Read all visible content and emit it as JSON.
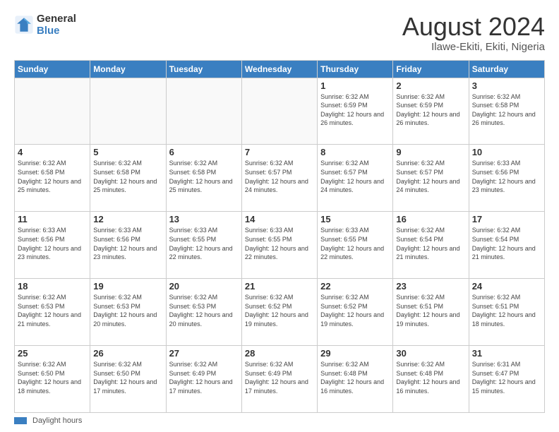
{
  "logo": {
    "line1": "General",
    "line2": "Blue"
  },
  "title": "August 2024",
  "location": "Ilawe-Ekiti, Ekiti, Nigeria",
  "days_of_week": [
    "Sunday",
    "Monday",
    "Tuesday",
    "Wednesday",
    "Thursday",
    "Friday",
    "Saturday"
  ],
  "footer_label": "Daylight hours",
  "weeks": [
    [
      {
        "day": "",
        "info": ""
      },
      {
        "day": "",
        "info": ""
      },
      {
        "day": "",
        "info": ""
      },
      {
        "day": "",
        "info": ""
      },
      {
        "day": "1",
        "info": "Sunrise: 6:32 AM\nSunset: 6:59 PM\nDaylight: 12 hours and 26 minutes."
      },
      {
        "day": "2",
        "info": "Sunrise: 6:32 AM\nSunset: 6:59 PM\nDaylight: 12 hours and 26 minutes."
      },
      {
        "day": "3",
        "info": "Sunrise: 6:32 AM\nSunset: 6:58 PM\nDaylight: 12 hours and 26 minutes."
      }
    ],
    [
      {
        "day": "4",
        "info": "Sunrise: 6:32 AM\nSunset: 6:58 PM\nDaylight: 12 hours and 25 minutes."
      },
      {
        "day": "5",
        "info": "Sunrise: 6:32 AM\nSunset: 6:58 PM\nDaylight: 12 hours and 25 minutes."
      },
      {
        "day": "6",
        "info": "Sunrise: 6:32 AM\nSunset: 6:58 PM\nDaylight: 12 hours and 25 minutes."
      },
      {
        "day": "7",
        "info": "Sunrise: 6:32 AM\nSunset: 6:57 PM\nDaylight: 12 hours and 24 minutes."
      },
      {
        "day": "8",
        "info": "Sunrise: 6:32 AM\nSunset: 6:57 PM\nDaylight: 12 hours and 24 minutes."
      },
      {
        "day": "9",
        "info": "Sunrise: 6:32 AM\nSunset: 6:57 PM\nDaylight: 12 hours and 24 minutes."
      },
      {
        "day": "10",
        "info": "Sunrise: 6:33 AM\nSunset: 6:56 PM\nDaylight: 12 hours and 23 minutes."
      }
    ],
    [
      {
        "day": "11",
        "info": "Sunrise: 6:33 AM\nSunset: 6:56 PM\nDaylight: 12 hours and 23 minutes."
      },
      {
        "day": "12",
        "info": "Sunrise: 6:33 AM\nSunset: 6:56 PM\nDaylight: 12 hours and 23 minutes."
      },
      {
        "day": "13",
        "info": "Sunrise: 6:33 AM\nSunset: 6:55 PM\nDaylight: 12 hours and 22 minutes."
      },
      {
        "day": "14",
        "info": "Sunrise: 6:33 AM\nSunset: 6:55 PM\nDaylight: 12 hours and 22 minutes."
      },
      {
        "day": "15",
        "info": "Sunrise: 6:33 AM\nSunset: 6:55 PM\nDaylight: 12 hours and 22 minutes."
      },
      {
        "day": "16",
        "info": "Sunrise: 6:32 AM\nSunset: 6:54 PM\nDaylight: 12 hours and 21 minutes."
      },
      {
        "day": "17",
        "info": "Sunrise: 6:32 AM\nSunset: 6:54 PM\nDaylight: 12 hours and 21 minutes."
      }
    ],
    [
      {
        "day": "18",
        "info": "Sunrise: 6:32 AM\nSunset: 6:53 PM\nDaylight: 12 hours and 21 minutes."
      },
      {
        "day": "19",
        "info": "Sunrise: 6:32 AM\nSunset: 6:53 PM\nDaylight: 12 hours and 20 minutes."
      },
      {
        "day": "20",
        "info": "Sunrise: 6:32 AM\nSunset: 6:53 PM\nDaylight: 12 hours and 20 minutes."
      },
      {
        "day": "21",
        "info": "Sunrise: 6:32 AM\nSunset: 6:52 PM\nDaylight: 12 hours and 19 minutes."
      },
      {
        "day": "22",
        "info": "Sunrise: 6:32 AM\nSunset: 6:52 PM\nDaylight: 12 hours and 19 minutes."
      },
      {
        "day": "23",
        "info": "Sunrise: 6:32 AM\nSunset: 6:51 PM\nDaylight: 12 hours and 19 minutes."
      },
      {
        "day": "24",
        "info": "Sunrise: 6:32 AM\nSunset: 6:51 PM\nDaylight: 12 hours and 18 minutes."
      }
    ],
    [
      {
        "day": "25",
        "info": "Sunrise: 6:32 AM\nSunset: 6:50 PM\nDaylight: 12 hours and 18 minutes."
      },
      {
        "day": "26",
        "info": "Sunrise: 6:32 AM\nSunset: 6:50 PM\nDaylight: 12 hours and 17 minutes."
      },
      {
        "day": "27",
        "info": "Sunrise: 6:32 AM\nSunset: 6:49 PM\nDaylight: 12 hours and 17 minutes."
      },
      {
        "day": "28",
        "info": "Sunrise: 6:32 AM\nSunset: 6:49 PM\nDaylight: 12 hours and 17 minutes."
      },
      {
        "day": "29",
        "info": "Sunrise: 6:32 AM\nSunset: 6:48 PM\nDaylight: 12 hours and 16 minutes."
      },
      {
        "day": "30",
        "info": "Sunrise: 6:32 AM\nSunset: 6:48 PM\nDaylight: 12 hours and 16 minutes."
      },
      {
        "day": "31",
        "info": "Sunrise: 6:31 AM\nSunset: 6:47 PM\nDaylight: 12 hours and 15 minutes."
      }
    ]
  ]
}
